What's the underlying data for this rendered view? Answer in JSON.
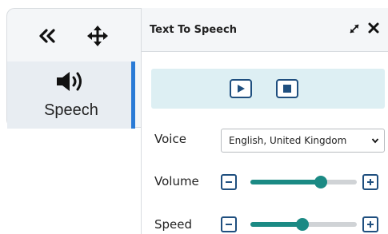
{
  "toolbar": {
    "collapse_icon": "double-chevron-left-icon",
    "move_icon": "move-arrows-icon",
    "speech_icon": "speaker-icon",
    "speech_label": "Speech",
    "accent_color": "#2b7bd6"
  },
  "panel": {
    "title": "Text To Speech",
    "expand_icon": "expand-icon",
    "close_icon": "close-icon"
  },
  "controls": {
    "play_icon": "play-icon",
    "stop_icon": "stop-icon",
    "background": "#ddeff3"
  },
  "voice": {
    "label": "Voice",
    "selected": "English, United Kingdom"
  },
  "volume": {
    "label": "Volume",
    "value_fraction": 0.66
  },
  "speed": {
    "label": "Speed",
    "value_fraction": 0.49
  },
  "slider_color": "#1b8a84"
}
